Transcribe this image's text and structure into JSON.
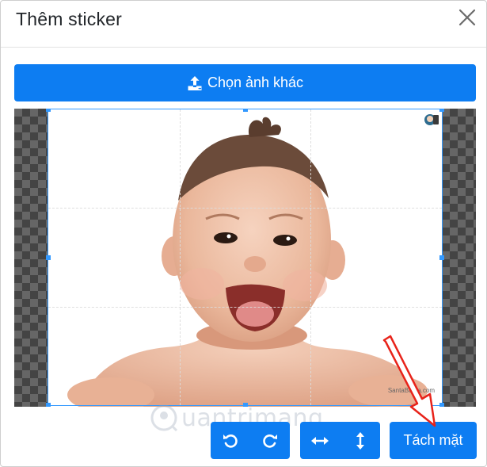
{
  "modal": {
    "title": "Thêm sticker",
    "close_icon": "close-icon"
  },
  "upload": {
    "label": "Chọn ảnh khác",
    "icon": "upload-icon"
  },
  "image": {
    "credit": "SantaBanta.com",
    "badge_icon": "site-badge-icon"
  },
  "toolbar": {
    "rotate_left_icon": "rotate-left-icon",
    "rotate_right_icon": "rotate-right-icon",
    "flip_horizontal_icon": "flip-horizontal-icon",
    "flip_vertical_icon": "flip-vertical-icon",
    "face_label": "Tách mặt"
  },
  "watermark": {
    "brand": "uantrimang"
  },
  "colors": {
    "primary": "#0d7df2",
    "crop_border": "#3399ff",
    "annotation_arrow": "#e8231a"
  }
}
